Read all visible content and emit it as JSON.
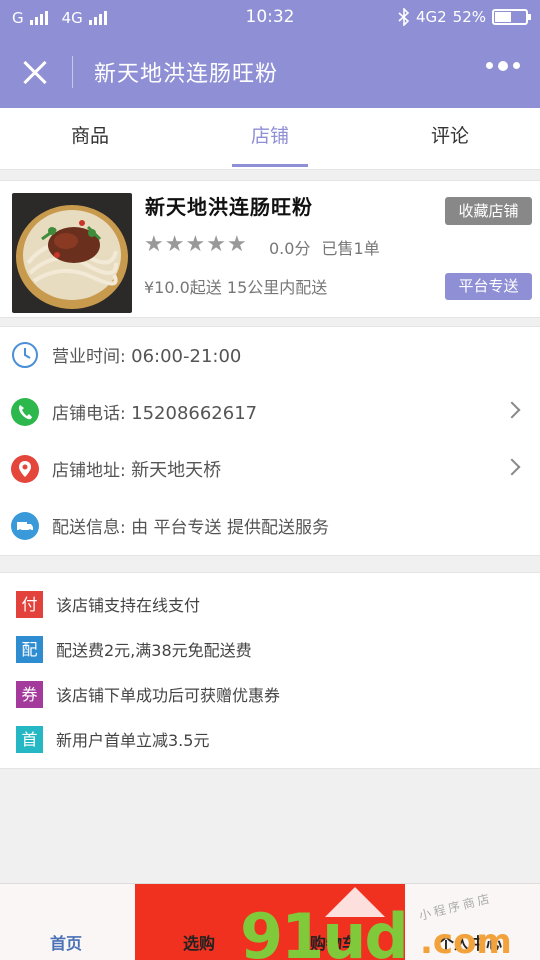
{
  "status_bar": {
    "carrier1": "G",
    "carrier2": "4G",
    "time": "10:32",
    "network": "4G2",
    "battery": "52%",
    "battery_level": 0.52
  },
  "title_bar": {
    "title": "新天地洪连肠旺粉"
  },
  "tabs": [
    {
      "label": "商品",
      "active": false
    },
    {
      "label": "店铺",
      "active": true
    },
    {
      "label": "评论",
      "active": false
    }
  ],
  "shop": {
    "name": "新天地洪连肠旺粉",
    "favorite_label": "收藏店铺",
    "rating_stars": 0,
    "rating_text": "0.0分",
    "sold_text": "已售1单",
    "delivery_text": "¥10.0起送 15公里内配送",
    "delivery_badge": "平台专送"
  },
  "info": {
    "hours": {
      "label": "营业时间:",
      "value": "06:00-21:00"
    },
    "phone": {
      "label": "店铺电话:",
      "value": "15208662617"
    },
    "address": {
      "label": "店铺地址:",
      "value": "新天地天桥"
    },
    "delivery": {
      "label": "配送信息:",
      "value": "由 平台专送 提供配送服务"
    }
  },
  "promos": [
    {
      "tag": "付",
      "text": "该店铺支持在线支付",
      "color": "#e3413c"
    },
    {
      "tag": "配",
      "text": "配送费2元,满38元免配送费",
      "color": "#2e8cd0"
    },
    {
      "tag": "券",
      "text": "该店铺下单成功后可获赠优惠券",
      "color": "#a33a9c"
    },
    {
      "tag": "首",
      "text": "新用户首单立减3.5元",
      "color": "#25b8c4"
    }
  ],
  "bottom_nav": {
    "home": "首页",
    "select": "选购",
    "cart": "购物车",
    "profile": "个人中心"
  },
  "watermark": {
    "main": "91ud",
    "suffix": ".com",
    "tagline": "小程序商店"
  },
  "colors": {
    "accent": "#8f8fd6",
    "red": "#f1311f"
  }
}
